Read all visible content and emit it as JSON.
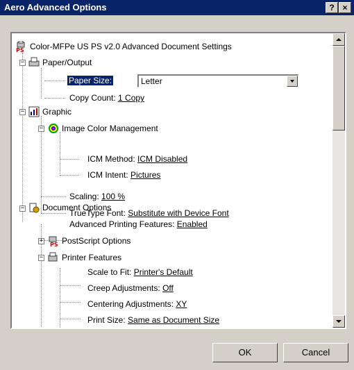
{
  "window": {
    "title": "Aero Advanced Options",
    "help_glyph": "?",
    "close_glyph": "×"
  },
  "tree": {
    "root": "Color-MFPe US PS v2.0 Advanced Document Settings",
    "paper_output": "Paper/Output",
    "paper_size_label": "Paper Size:",
    "paper_size_value": "Letter",
    "copy_count_label": "Copy Count:",
    "copy_count_value": "1 Copy",
    "graphic": "Graphic",
    "icm": "Image Color Management",
    "icm_method_label": "ICM Method:",
    "icm_method_value": "ICM Disabled",
    "icm_intent_label": "ICM Intent:",
    "icm_intent_value": "Pictures",
    "scaling_label": "Scaling:",
    "scaling_value": "100 %",
    "truetype_label": "TrueType Font:",
    "truetype_value": "Substitute with Device Font",
    "doc_options": "Document Options",
    "adv_printing_label": "Advanced Printing Features:",
    "adv_printing_value": "Enabled",
    "postscript_options": "PostScript Options",
    "printer_features": "Printer Features",
    "scale_fit_label": "Scale to Fit:",
    "scale_fit_value": "Printer's Default",
    "creep_label": "Creep Adjustments:",
    "creep_value": "Off",
    "centering_label": "Centering Adjustments:",
    "centering_value": "XY",
    "print_size_label": "Print Size:",
    "print_size_value": "Same as Document Size",
    "expand_minus": "−",
    "expand_plus": "+"
  },
  "buttons": {
    "ok": "OK",
    "cancel": "Cancel"
  },
  "colors": {
    "titlebar": "#0a246a",
    "face": "#d4d0c8",
    "selection": "#0a246a"
  }
}
